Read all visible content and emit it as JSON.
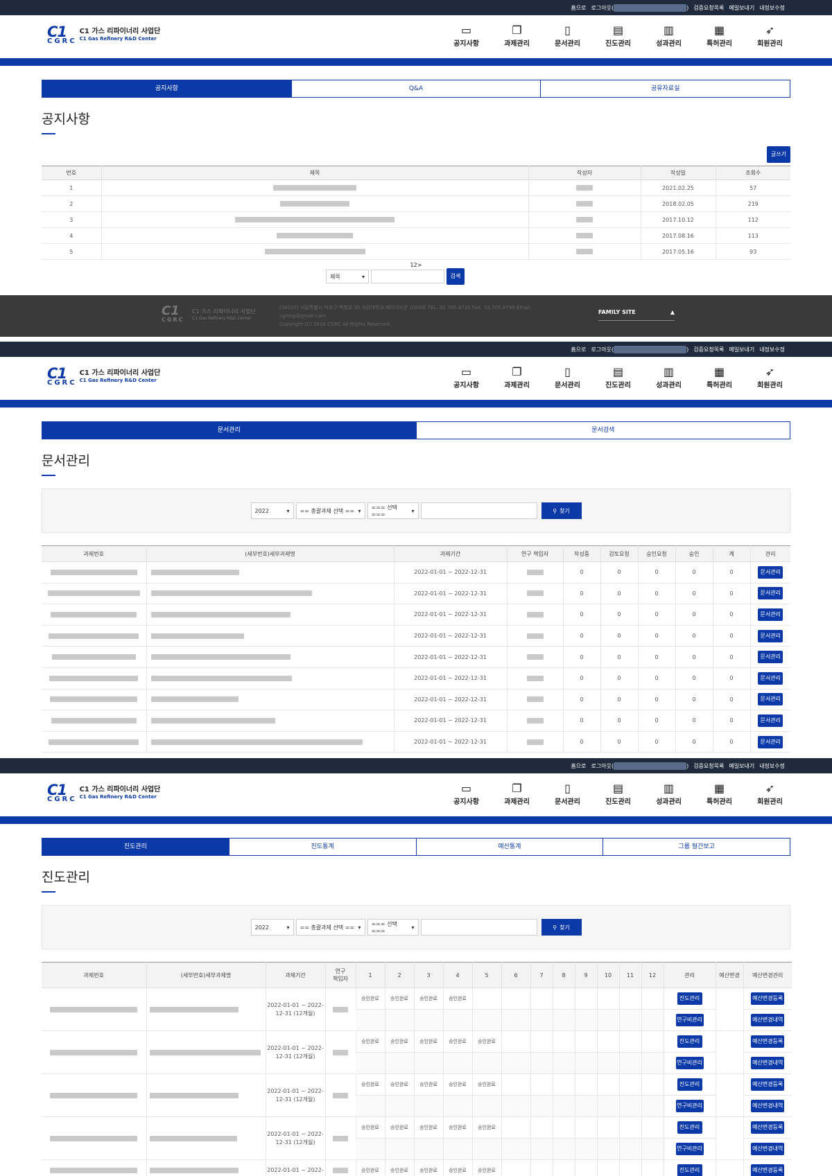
{
  "util": {
    "home": "홈으로",
    "logout": "로그아웃(",
    "close_paren": ")",
    "links": [
      "검증요청목록",
      "메일보내기",
      "내정보수정"
    ]
  },
  "logo": {
    "mark": "C1",
    "sub": "CGRC",
    "name": "C1 가스 리파이너리 사업단",
    "name_en": "C1 Gas Refinery R&D Center"
  },
  "gnb": [
    {
      "label": "공지사항",
      "icon": "notice-icon",
      "glyph": "▭"
    },
    {
      "label": "과제관리",
      "icon": "documents-icon",
      "glyph": "❐"
    },
    {
      "label": "문서관리",
      "icon": "file-icon",
      "glyph": "▯"
    },
    {
      "label": "진도관리",
      "icon": "clipboard-icon",
      "glyph": "▤"
    },
    {
      "label": "성과관리",
      "icon": "bar-chart-icon",
      "glyph": "▥"
    },
    {
      "label": "특허관리",
      "icon": "patent-icon",
      "glyph": "▦"
    },
    {
      "label": "회원관리",
      "icon": "runner-icon",
      "glyph": "➶"
    }
  ],
  "notice": {
    "tabs": [
      "공지사항",
      "Q&A",
      "공유자료실"
    ],
    "title": "공지사항",
    "write_label": "글쓰기",
    "headers": [
      "번호",
      "제목",
      "작성자",
      "작성일",
      "조회수"
    ],
    "rows": [
      {
        "no": "1",
        "date": "2021.02.25",
        "views": "57"
      },
      {
        "no": "2",
        "date": "2018.02.05",
        "views": "219"
      },
      {
        "no": "3",
        "date": "2017.10.12",
        "views": "112"
      },
      {
        "no": "4",
        "date": "2017.08.16",
        "views": "113"
      },
      {
        "no": "5",
        "date": "2017.05.16",
        "views": "93"
      }
    ],
    "pagination": "12>",
    "search_select": "제목",
    "search_button": "검색"
  },
  "footer": {
    "logo": "C1",
    "logo_sub": "CGRC",
    "name": "C1 가스 리파이너리 사업단",
    "name_en": "C1 Gas Refinery R&D Center",
    "addr1": "[04107] 서울특별시 마포구 백범로 35 서강대학교 베이야드관 1008호 TEL. 02.705.8710 FAX. 02.705.8799 Email.",
    "addr2": "cgrcsg@gmail.com",
    "addr3": "Copyright (C) 2016 CGRC All Rights Reserved.",
    "family": "FAMILY SITE",
    "family_arrow": "▲"
  },
  "docs": {
    "tabs": [
      "문서관리",
      "문서검색"
    ],
    "title": "문서관리",
    "year": "2022",
    "select1": "== 총괄과제 선택 ==",
    "select2": "=== 선택 ===",
    "find": "찾기",
    "headers": [
      "과제번호",
      "(세부번호)세부과제명",
      "과제기간",
      "연구 책임자",
      "작성중",
      "검토요청",
      "승인요청",
      "승인",
      "계",
      "관리"
    ],
    "period": "2022-01-01 ~ 2022-12-31",
    "zero": "0",
    "manage_button": "문서관리",
    "row_count": 9
  },
  "progress": {
    "tabs": [
      "진도관리",
      "진도통계",
      "예산통계",
      "그룹 월간보고"
    ],
    "title": "진도관리",
    "year": "2022",
    "select1": "== 총괄과제 선택 ==",
    "select2": "=== 선택 ===",
    "find": "찾기",
    "headers": [
      "과제번호",
      "(세부번호)세부과제명",
      "과제기간",
      "연구\n책임자",
      "1",
      "2",
      "3",
      "4",
      "5",
      "6",
      "7",
      "8",
      "9",
      "10",
      "11",
      "12",
      "관리",
      "예산변경",
      "예산변경관리"
    ],
    "period": "2022-01-01 ~ 2022-12-31 (12개월)",
    "period_partial": "2022-01-01 ~ 2022-",
    "approved": "승인완료",
    "btn_progress": "진도관리",
    "btn_research": "연구비관리",
    "btn_budget_reg": "예산변경등록",
    "btn_budget_hist": "예산변경내역",
    "rows_months": [
      4,
      5,
      5,
      5,
      5
    ]
  }
}
